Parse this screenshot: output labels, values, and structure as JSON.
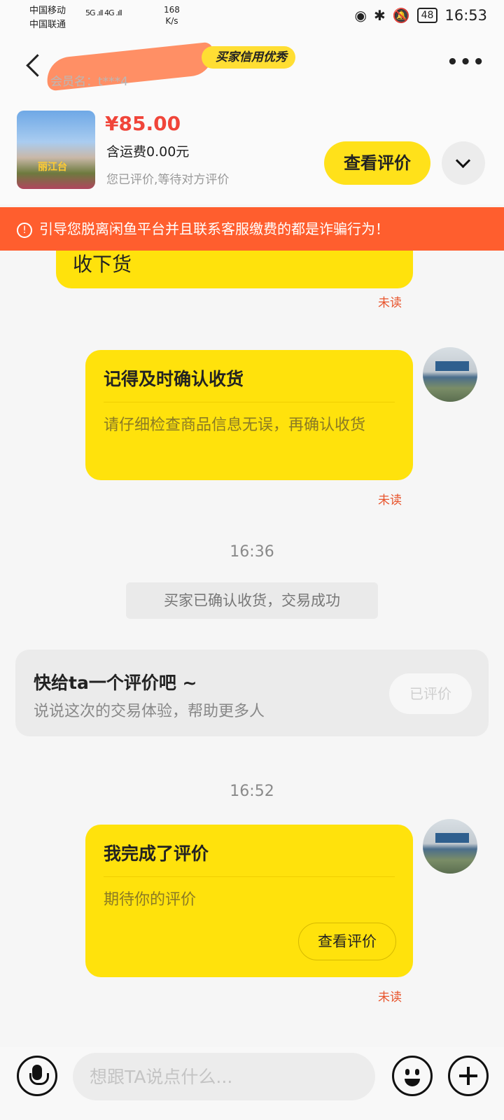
{
  "status_bar": {
    "carrier1": "中国移动",
    "carrier2": "中国联通",
    "signal": "5G .ıll 4G .ıll",
    "speed_value": "168",
    "speed_unit": "K/s",
    "battery": "48",
    "time": "16:53"
  },
  "header": {
    "badge": "买家信用优秀",
    "member_label": "会员名：t***4",
    "more": "•••"
  },
  "product": {
    "price": "¥85.00",
    "shipping": "含运费0.00元",
    "status": "您已评价,等待对方评价",
    "review_button": "查看评价",
    "thumb_text": "丽江台"
  },
  "warning": {
    "icon": "!",
    "text": "引导您脱离闲鱼平台并且联系客服缴费的都是诈骗行为！"
  },
  "messages": {
    "m1_text": "收下货",
    "m1_status": "未读",
    "m2_title": "记得及时确认收货",
    "m2_body": "请仔细检查商品信息无误，再确认收货",
    "m2_status": "未读",
    "time1": "16:36",
    "system": "买家已确认收货，交易成功",
    "review_card_title": "快给ta一个评价吧 ~",
    "review_card_sub": "说说这次的交易体验，帮助更多人",
    "review_card_button": "已评价",
    "time2": "16:52",
    "m3_title": "我完成了评价",
    "m3_body": "期待你的评价",
    "m3_button": "查看评价",
    "m3_status": "未读"
  },
  "input": {
    "placeholder": "想跟TA说点什么..."
  }
}
